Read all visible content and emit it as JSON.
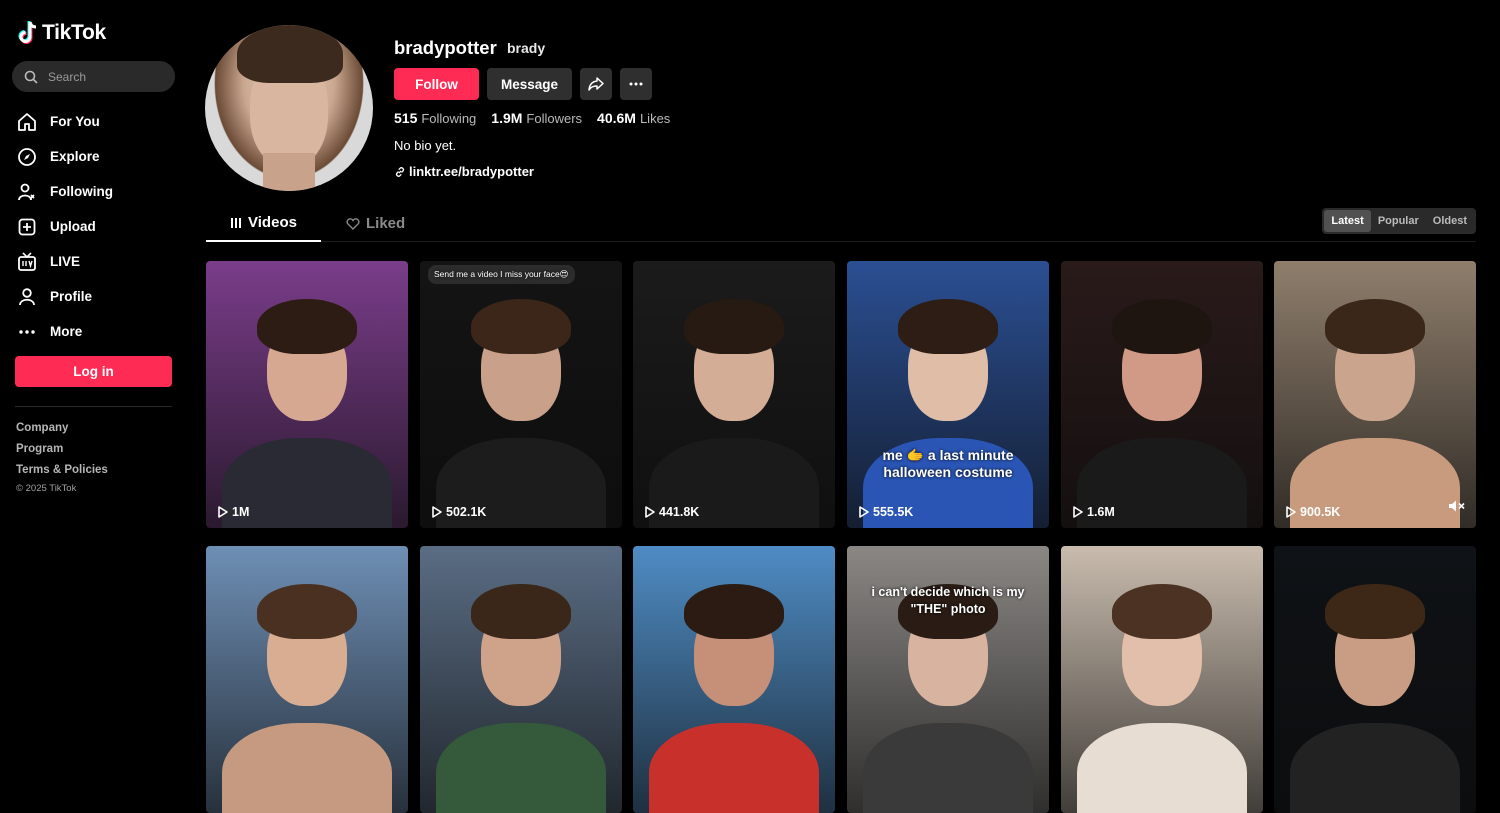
{
  "app": {
    "name": "TikTok"
  },
  "sidebar": {
    "search_placeholder": "Search",
    "items": [
      {
        "label": "For You",
        "icon": "home-icon"
      },
      {
        "label": "Explore",
        "icon": "compass-icon"
      },
      {
        "label": "Following",
        "icon": "following-icon"
      },
      {
        "label": "Upload",
        "icon": "upload-icon"
      },
      {
        "label": "LIVE",
        "icon": "live-icon"
      },
      {
        "label": "Profile",
        "icon": "profile-icon"
      },
      {
        "label": "More",
        "icon": "more-icon"
      }
    ],
    "login_label": "Log in",
    "footer_links": [
      "Company",
      "Program",
      "Terms & Policies"
    ],
    "copyright": "© 2025 TikTok"
  },
  "profile": {
    "username": "bradypotter",
    "nickname": "brady",
    "follow_label": "Follow",
    "message_label": "Message",
    "stats": [
      {
        "value": "515",
        "label": "Following"
      },
      {
        "value": "1.9M",
        "label": "Followers"
      },
      {
        "value": "40.6M",
        "label": "Likes"
      }
    ],
    "bio": "No bio yet.",
    "link": "linktr.ee/bradypotter"
  },
  "tabs": {
    "videos": "Videos",
    "liked": "Liked"
  },
  "sort": {
    "options": [
      "Latest",
      "Popular",
      "Oldest"
    ],
    "selected": "Latest"
  },
  "videos": [
    {
      "views": "1M",
      "bg": "#7a3d8a"
    },
    {
      "views": "502.1K",
      "bg": "#141414",
      "top_text": "Send me a video I miss your face😍"
    },
    {
      "views": "441.8K",
      "bg": "#1b1b1b"
    },
    {
      "views": "555.5K",
      "bg": "#2b4f93",
      "overlay": [
        "me 🫱 a last minute",
        "halloween costume"
      ]
    },
    {
      "views": "1.6M",
      "bg": "#2a1a1a"
    },
    {
      "views": "900.5K",
      "bg": "#8f7e6c",
      "muted": true
    },
    {
      "views": "",
      "bg": "#6e8fb5"
    },
    {
      "views": "",
      "bg": "#5a6d84"
    },
    {
      "views": "",
      "bg": "#4f8cc4"
    },
    {
      "views": "",
      "bg": "#8a8784",
      "overlay": [
        "i can't decide which is my",
        "\"THE\" photo"
      ]
    },
    {
      "views": "",
      "bg": "#c9bcae"
    },
    {
      "views": "",
      "bg": "#0f1216"
    }
  ],
  "colors": {
    "accent": "#fe2c55",
    "background": "#000000"
  }
}
